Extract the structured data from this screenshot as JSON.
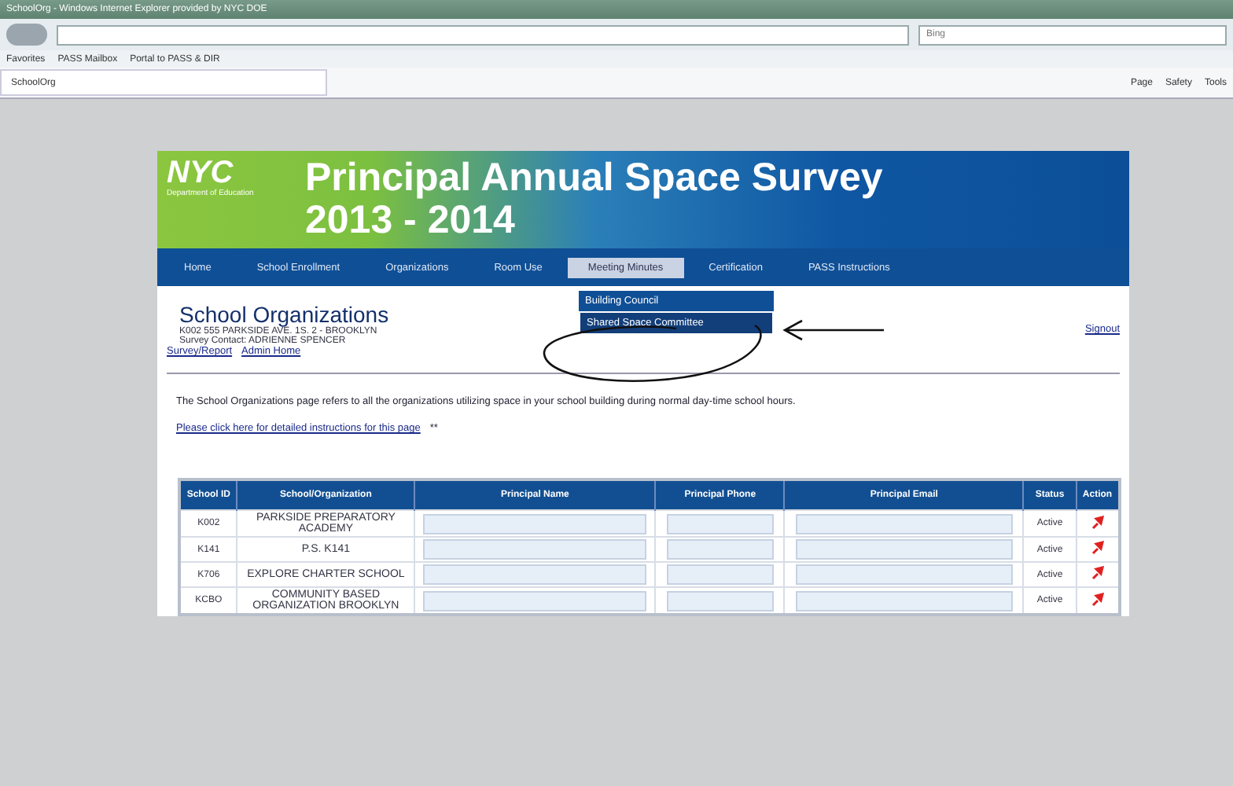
{
  "browser": {
    "title": "SchoolOrg - Windows Internet Explorer provided by NYC DOE",
    "search_placeholder": "Bing",
    "favorites": [
      "Favorites",
      "PASS Mailbox",
      "Portal to PASS & DIR"
    ],
    "tab": "SchoolOrg",
    "commands": [
      "Page",
      "Safety",
      "Tools"
    ]
  },
  "header": {
    "logo": "NYC",
    "logo_subtitle": "Department of Education",
    "title": "Principal Annual Space Survey",
    "years": "2013 - 2014"
  },
  "nav": [
    {
      "label": "Home",
      "selected": false
    },
    {
      "label": "School Enrollment",
      "selected": false
    },
    {
      "label": "Organizations",
      "selected": false
    },
    {
      "label": "Room Use",
      "selected": false
    },
    {
      "label": "Meeting Minutes",
      "selected": true,
      "menu": [
        {
          "label": "Building Council",
          "selected": false
        },
        {
          "label": "Shared Space Committee",
          "selected": true
        }
      ]
    },
    {
      "label": "Certification",
      "selected": false
    },
    {
      "label": "PASS Instructions",
      "selected": false
    }
  ],
  "section": {
    "title": "School Organizations",
    "address": "K002 555 PARKSIDE AVE. 1S. 2 - BROOKLYN",
    "contact": "Survey Contact: ADRIENNE SPENCER",
    "links": [
      "Survey/Report",
      "Admin Home"
    ],
    "signout": "Signout"
  },
  "intro": "The School Organizations page refers to all the organizations utilizing space in your school building during normal day-time school hours.",
  "instructions_link": "Please click here for detailed instructions for this page",
  "instructions_mark": "**",
  "table": {
    "columns": [
      "School ID",
      "School/Organization",
      "Principal Name",
      "Principal Phone",
      "Principal Email",
      "Status",
      "Action"
    ],
    "rows": [
      {
        "id": "K002",
        "organization": "PARKSIDE PREPARATORY ACADEMY",
        "status": "Active"
      },
      {
        "id": "K141",
        "organization": "P.S. K141",
        "status": "Active"
      },
      {
        "id": "K706",
        "organization": "EXPLORE CHARTER SCHOOL",
        "status": "Active"
      },
      {
        "id": "KCBO",
        "organization": "COMMUNITY BASED ORGANIZATION BROOKLYN",
        "status": "Active"
      }
    ]
  }
}
